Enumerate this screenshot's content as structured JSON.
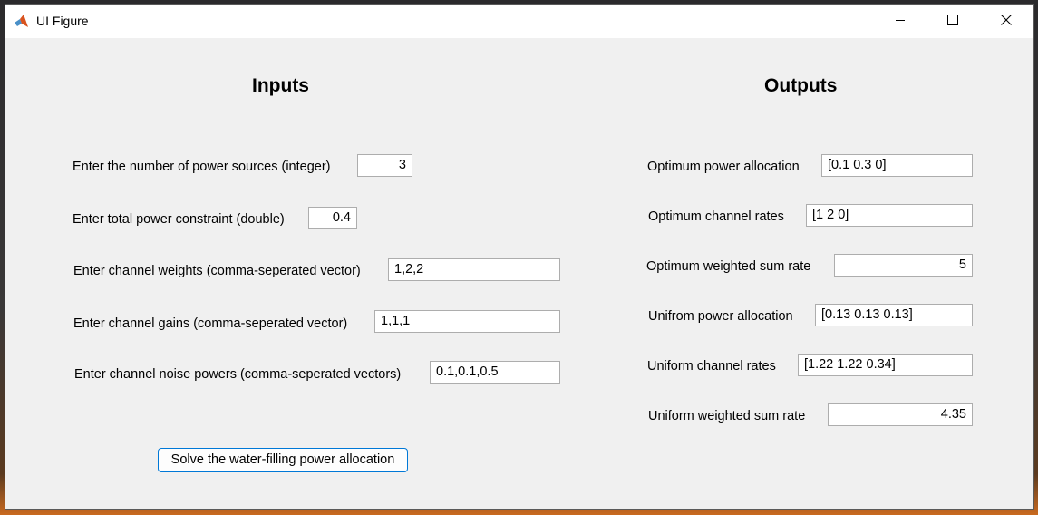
{
  "window": {
    "title": "UI Figure",
    "app_icon": "matlab-logo-icon",
    "controls": [
      "minimize-icon",
      "maximize-icon",
      "close-icon"
    ]
  },
  "inputs": {
    "heading": "Inputs",
    "num_sources": {
      "label": "Enter the number of power sources (integer)",
      "value": "3"
    },
    "total_power": {
      "label": "Enter total power constraint (double)",
      "value": "0.4"
    },
    "weights": {
      "label": "Enter channel weights (comma-seperated vector)",
      "value": "1,2,2"
    },
    "gains": {
      "label": "Enter channel gains (comma-seperated vector)",
      "value": "1,1,1"
    },
    "noise": {
      "label": "Enter channel noise powers (comma-seperated vectors)",
      "value": "0.1,0.1,0.5"
    },
    "solve_button": "Solve the water-filling power allocation"
  },
  "outputs": {
    "heading": "Outputs",
    "opt_power": {
      "label": "Optimum power allocation",
      "value": "[0.1 0.3 0]"
    },
    "opt_rates": {
      "label": "Optimum channel rates",
      "value": "[1 2 0]"
    },
    "opt_sum": {
      "label": "Optimum weighted sum rate",
      "value": "5"
    },
    "uni_power": {
      "label": "Unifrom power allocation",
      "value": "[0.13 0.13 0.13]"
    },
    "uni_rates": {
      "label": "Uniform channel rates",
      "value": "[1.22 1.22 0.34]"
    },
    "uni_sum": {
      "label": "Uniform weighted sum rate",
      "value": "4.35"
    }
  },
  "colors": {
    "window_bg": "#f0f0f0",
    "titlebar_bg": "#ffffff",
    "button_border": "#0078d7",
    "field_border": "#adadad"
  }
}
